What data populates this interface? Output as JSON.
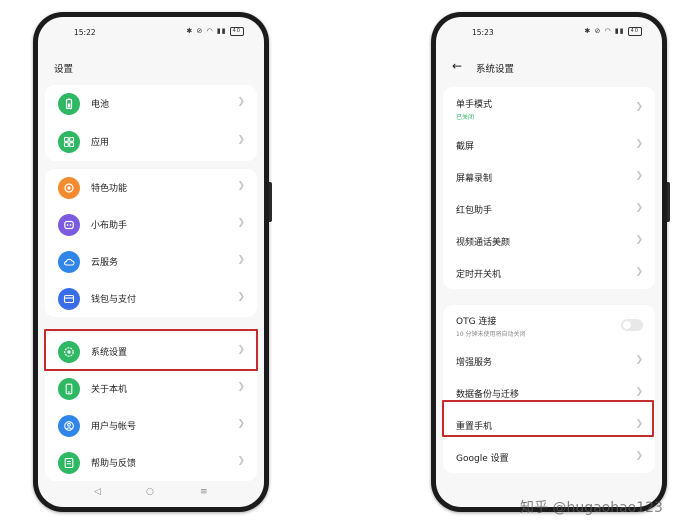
{
  "left_phone": {
    "time": "15:22",
    "title": "设置",
    "items_group1": [
      {
        "label": "电池",
        "icon": "battery-icon",
        "color": "#2fb864"
      },
      {
        "label": "应用",
        "icon": "apps-grid-icon",
        "color": "#2fb864"
      }
    ],
    "items_group2": [
      {
        "label": "特色功能",
        "icon": "star-feature-icon",
        "color": "#f28b30"
      },
      {
        "label": "小布助手",
        "icon": "assistant-icon",
        "color": "#7b5ce0"
      },
      {
        "label": "云服务",
        "icon": "cloud-icon",
        "color": "#2f86e8"
      },
      {
        "label": "钱包与支付",
        "icon": "wallet-icon",
        "color": "#3a6ee8"
      }
    ],
    "items_group3": [
      {
        "label": "系统设置",
        "icon": "system-settings-icon",
        "color": "#2fb864"
      },
      {
        "label": "关于本机",
        "icon": "phone-icon",
        "color": "#2fb864"
      },
      {
        "label": "用户与帐号",
        "icon": "user-account-icon",
        "color": "#2f86e8"
      },
      {
        "label": "帮助与反馈",
        "icon": "help-icon",
        "color": "#2fb864"
      }
    ]
  },
  "right_phone": {
    "time": "15:23",
    "title": "系统设置",
    "items_group1": [
      {
        "label": "单手模式",
        "sub": "已关闭"
      },
      {
        "label": "截屏"
      },
      {
        "label": "屏幕录制"
      },
      {
        "label": "红包助手"
      },
      {
        "label": "视频通话美颜"
      },
      {
        "label": "定时开关机"
      }
    ],
    "items_group2": [
      {
        "label": "OTG 连接",
        "sub": "10 分钟未使用将自动关闭"
      },
      {
        "label": "增强服务"
      },
      {
        "label": "数据备份与迁移"
      },
      {
        "label": "重置手机"
      },
      {
        "label": "Google 设置"
      }
    ]
  },
  "status": {
    "battery": "40",
    "icons": "✱ ⊘ ◠ ▮▮"
  },
  "nav": {
    "back": "◁",
    "home": "○",
    "menu": "≡"
  },
  "watermark": "知乎 @hugaohao123",
  "colors": {
    "highlight": "#c42b2b",
    "sub_green": "#2fb864"
  }
}
